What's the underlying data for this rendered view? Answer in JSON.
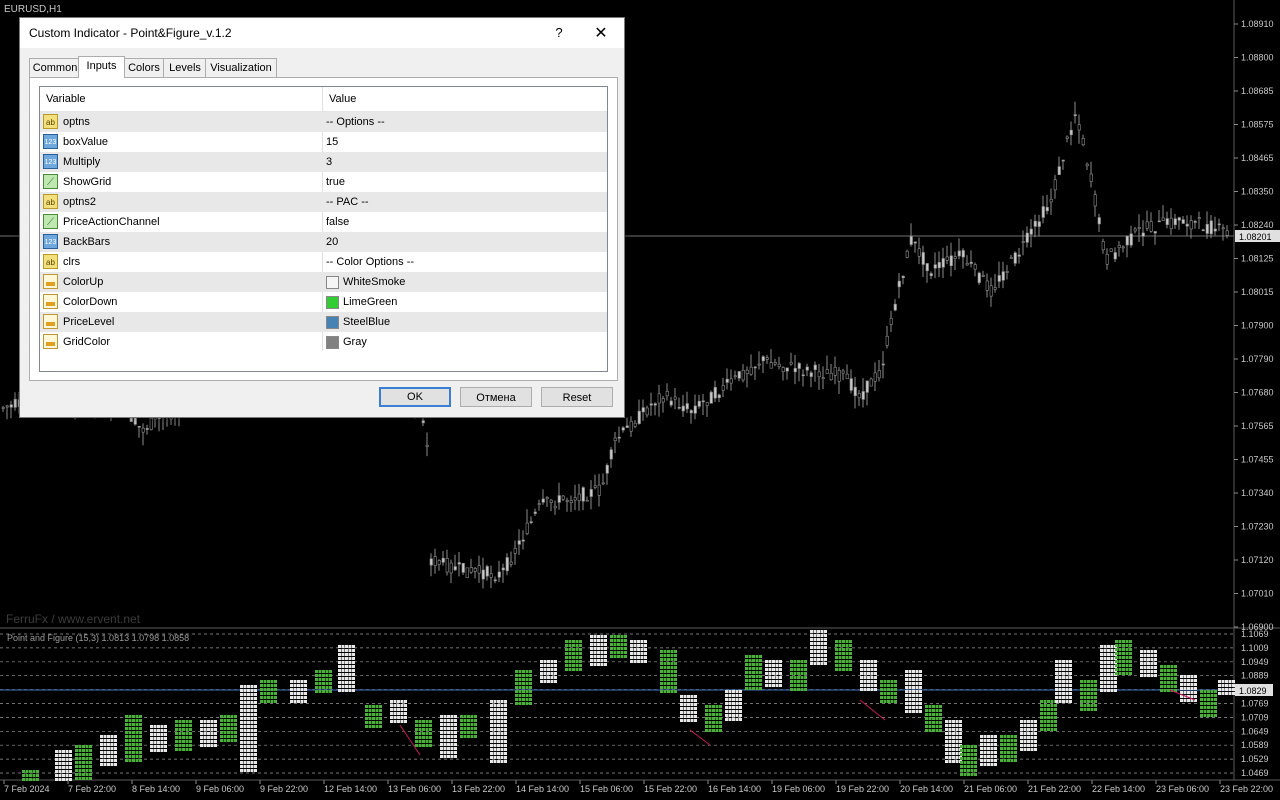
{
  "chart": {
    "symbol": "EURUSD,H1",
    "watermark": "FerruFx / www.ervent.net",
    "subtitle": "Point and Figure (15,3) 1.0813 1.0798 1.0858",
    "price_current": "1.08201",
    "price_scale": [
      "1.08910",
      "1.08800",
      "1.08685",
      "1.08575",
      "1.08465",
      "1.08350",
      "1.08240",
      "1.08125",
      "1.08015",
      "1.07900",
      "1.07790",
      "1.07680",
      "1.07565",
      "1.07455",
      "1.07340",
      "1.07230",
      "1.07120",
      "1.07010",
      "1.06900"
    ],
    "pf_current": "1.0829",
    "pf_scale": [
      "1.1069",
      "1.1009",
      "1.0949",
      "1.0889",
      "1.0829",
      "1.0769",
      "1.0709",
      "1.0649",
      "1.0589",
      "1.0529",
      "1.0469"
    ],
    "time_labels": [
      "7 Feb 2024",
      "7 Feb 22:00",
      "8 Feb 14:00",
      "9 Feb 06:00",
      "9 Feb 22:00",
      "12 Feb 14:00",
      "13 Feb 06:00",
      "13 Feb 22:00",
      "14 Feb 14:00",
      "15 Feb 06:00",
      "15 Feb 22:00",
      "16 Feb 14:00",
      "19 Feb 06:00",
      "19 Feb 22:00",
      "20 Feb 14:00",
      "21 Feb 06:00",
      "21 Feb 22:00",
      "22 Feb 14:00",
      "23 Feb 06:00",
      "23 Feb 22:00"
    ],
    "colors": {
      "candle": "#8c8c8c",
      "pf_x": "#4caf3c",
      "pf_o": "#e8e8e8",
      "grid": "#9a9a9a",
      "pf_level": "#4472c4",
      "price_line": "#6f6f6f",
      "down_line": "#c2185b"
    }
  },
  "dialog": {
    "title": "Custom Indicator - Point&Figure_v.1.2",
    "help": "?",
    "close": "✕",
    "tabs": [
      "Common",
      "Inputs",
      "Colors",
      "Levels",
      "Visualization"
    ],
    "active_tab": "Inputs",
    "columns": {
      "variable": "Variable",
      "value": "Value"
    },
    "rows": [
      {
        "icon": "ab",
        "name": "optns",
        "value": "-- Options --"
      },
      {
        "icon": "123",
        "name": "boxValue",
        "value": "15"
      },
      {
        "icon": "123",
        "name": "Multiply",
        "value": "3"
      },
      {
        "icon": "bool",
        "name": "ShowGrid",
        "value": "true"
      },
      {
        "icon": "ab",
        "name": "optns2",
        "value": "-- PAC --"
      },
      {
        "icon": "bool",
        "name": "PriceActionChannel",
        "value": "false"
      },
      {
        "icon": "123",
        "name": "BackBars",
        "value": "20"
      },
      {
        "icon": "ab",
        "name": "clrs",
        "value": "-- Color Options --"
      },
      {
        "icon": "color",
        "name": "ColorUp",
        "value": "WhiteSmoke",
        "color": "#f5f5f5"
      },
      {
        "icon": "color",
        "name": "ColorDown",
        "value": "LimeGreen",
        "color": "#32cd32"
      },
      {
        "icon": "color",
        "name": "PriceLevel",
        "value": "SteelBlue",
        "color": "#4682b4"
      },
      {
        "icon": "color",
        "name": "GridColor",
        "value": "Gray",
        "color": "#808080"
      }
    ],
    "buttons": {
      "ok": "OK",
      "cancel": "Отмена",
      "reset": "Reset"
    }
  }
}
